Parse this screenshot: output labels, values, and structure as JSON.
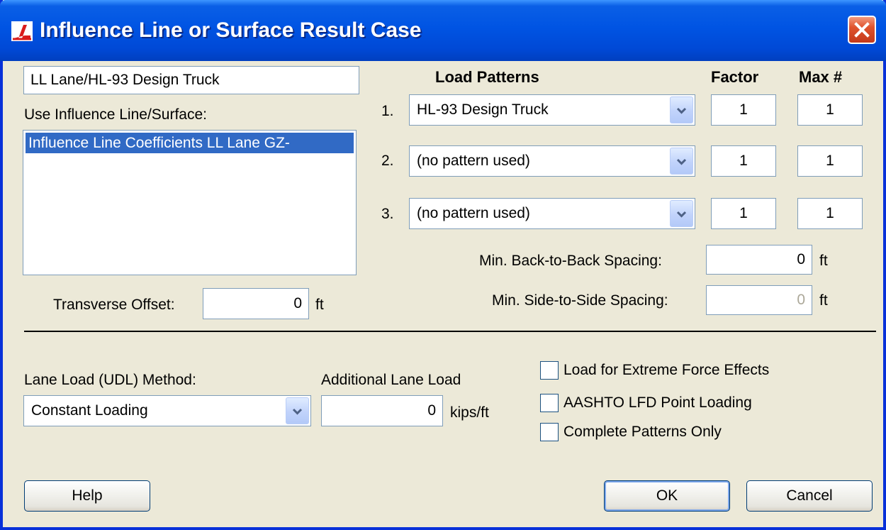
{
  "window": {
    "title": "Influence Line or Surface Result Case",
    "icon": "csibridge-app-icon",
    "close_icon": "close-icon"
  },
  "case_name": "LL Lane/HL-93 Design Truck",
  "influence": {
    "label": "Use Influence Line/Surface:",
    "items": [
      "Influence Line Coefficients LL Lane GZ-"
    ]
  },
  "transverse_offset": {
    "label": "Transverse Offset:",
    "value": "0",
    "unit": "ft"
  },
  "load_patterns": {
    "header": "Load Patterns",
    "factor_header": "Factor",
    "max_header": "Max #",
    "rows": [
      {
        "num": "1.",
        "pattern": "HL-93 Design Truck",
        "factor": "1",
        "max": "1"
      },
      {
        "num": "2.",
        "pattern": "(no pattern used)",
        "factor": "1",
        "max": "1"
      },
      {
        "num": "3.",
        "pattern": "(no pattern used)",
        "factor": "1",
        "max": "1"
      }
    ]
  },
  "back_to_back": {
    "label": "Min. Back-to-Back Spacing:",
    "value": "0",
    "unit": "ft"
  },
  "side_to_side": {
    "label": "Min. Side-to-Side Spacing:",
    "value": "0",
    "unit": "ft"
  },
  "lane_load": {
    "label": "Lane Load (UDL) Method:",
    "value": "Constant Loading"
  },
  "additional_lane_load": {
    "label": "Additional Lane Load",
    "value": "0",
    "unit": "kips/ft"
  },
  "options": [
    {
      "label": "Load for Extreme Force Effects",
      "checked": false
    },
    {
      "label": "AASHTO LFD Point Loading",
      "checked": false
    },
    {
      "label": "Complete Patterns Only",
      "checked": false
    }
  ],
  "buttons": {
    "help": "Help",
    "ok": "OK",
    "cancel": "Cancel"
  },
  "colors": {
    "titlebar": "#0054e3",
    "selection": "#316ac5",
    "face": "#ece9d8"
  }
}
